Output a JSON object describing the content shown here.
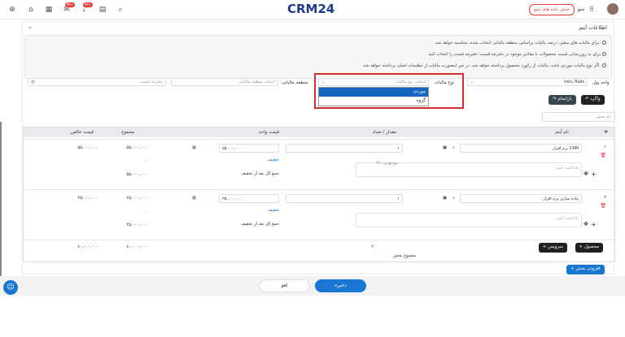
{
  "topbar": {
    "logo_main": "CRM",
    "logo_num": "24",
    "demo_label": "حذف داده های دمو",
    "menu_label": "منو",
    "badges": [
      "99+",
      "99+"
    ]
  },
  "panel": {
    "title": "اطلاعات آیتم",
    "info": [
      "برای مالیات های متغیر، درصد مالیات براساس منطقه مالیاتی انتخاب شده، محاسبه خواهد شد.",
      "برای به روزرسانی قیمت محصولات با مقادیر موجود در دفترچه قیمت؛ دفترچه قیمت را انتخاب کنید",
      "اگر نوع مالیات موردی باشد، مالیات از رکورد محصول برداشته خواهد شد. در غیر اینصورت مالیات از تنظیمات اصلی برداشته خواهد شد."
    ],
    "currency_label": "واحد پول",
    "currency_value": "Iran, Rials",
    "tax_type_label": "نوع مالیات",
    "tax_type_placeholder": "انتخاب نوع مالیات",
    "tax_options": [
      "موردی",
      "گروه"
    ],
    "tax_region_label": "منطقه مالیاتی",
    "tax_region_placeholder": "انتخاب منطقه مالیاتی",
    "price_book_placeholder": "دفترچه قیمت",
    "undo_label": "واگرد",
    "restore_label": "بازانجام",
    "section_name_placeholder": "نام بخش"
  },
  "table": {
    "headers": [
      "#",
      "نام آیتم",
      "مقدار / تعداد",
      "قیمت واحد",
      "مجموع",
      "قیمت خالص"
    ],
    "rows": [
      {
        "num": "۱",
        "name": "نرم افزار CRM",
        "desc_placeholder": "یادداشت آیتم",
        "qty": "۱",
        "stock": "موجودی: ۲۶",
        "unit_price": "۵۵,۰۰۰,۰۰۰",
        "discount": "تخفیف",
        "after_discount": "جمع کل بعد از تخفیف",
        "total": "۵۵,۰۰۰,۰۰۰",
        "total_discount": "۰",
        "total_after": "۵۵,۰۰۰,۰۰۰",
        "net": "۵۵,۰۰۰,۰۰۰"
      },
      {
        "num": "۲",
        "name": "پیاده سازی نرم افزار",
        "desc_placeholder": "یادداشت آیتم",
        "qty": "۱",
        "stock": "",
        "unit_price": "۲۵,۰۰۰,۰۰۰",
        "discount": "تخفیف",
        "after_discount": "جمع کل بعد از تخفیف",
        "total": "۲۵,۰۰۰,۰۰۰",
        "total_discount": "۰",
        "total_after": "۲۵,۰۰۰,۰۰۰",
        "net": "۲۵,۰۰۰,۰۰۰"
      }
    ],
    "summary": {
      "label": "مجموع بخش",
      "count": "۲",
      "total": "۸۰,۰۰۰,۰۰۰",
      "net": "۸۰,۰۰۰,۰۰۰"
    },
    "add_product": "محصول",
    "add_service": "سرویس",
    "add_section": "افزودن بخش"
  },
  "footer": {
    "save": "ذخیره",
    "cancel": "لغو"
  },
  "colors": {
    "brand": "#1e3a8a",
    "accent": "#1976d2",
    "danger": "#e53935",
    "highlight_box": "#d32f2f"
  }
}
